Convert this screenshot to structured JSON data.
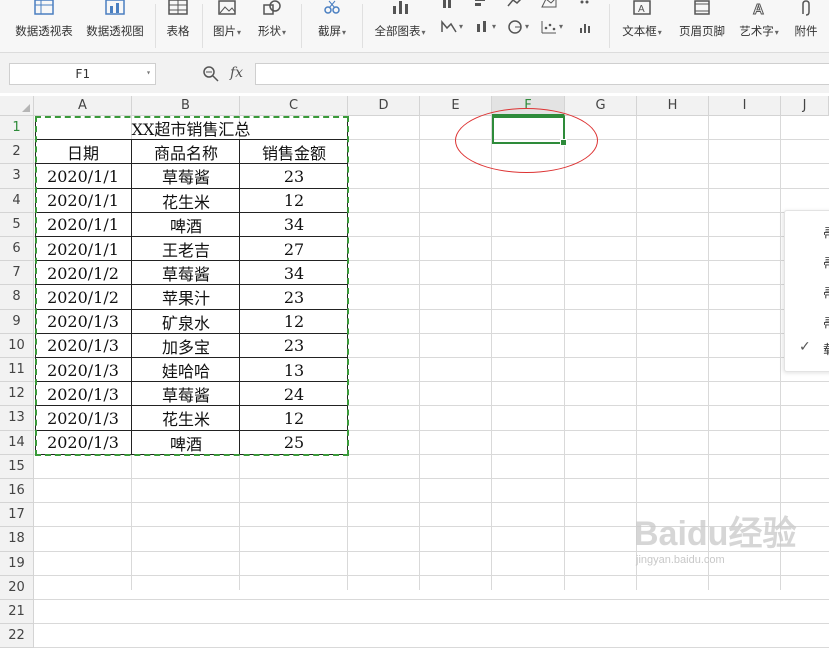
{
  "ribbon": {
    "items": [
      {
        "label": "数据透视表",
        "icon": "pivot-table-icon",
        "dropdown": false
      },
      {
        "label": "数据透视图",
        "icon": "pivot-chart-icon",
        "dropdown": false
      },
      {
        "label": "表格",
        "icon": "table-icon",
        "dropdown": false
      },
      {
        "label": "图片",
        "icon": "picture-icon",
        "dropdown": true
      },
      {
        "label": "形状",
        "icon": "shape-icon",
        "dropdown": true
      },
      {
        "label": "截屏",
        "icon": "screenshot-icon",
        "dropdown": true
      },
      {
        "label": "全部图表",
        "icon": "all-charts-icon",
        "dropdown": true
      },
      {
        "label": "文本框",
        "icon": "textbox-icon",
        "dropdown": true
      },
      {
        "label": "页眉页脚",
        "icon": "header-footer-icon",
        "dropdown": false
      },
      {
        "label": "艺术字",
        "icon": "wordart-icon",
        "dropdown": true
      },
      {
        "label": "附件",
        "icon": "attachment-icon",
        "dropdown": false
      }
    ]
  },
  "formula_bar": {
    "name_box": "F1",
    "fx": "fx",
    "formula": ""
  },
  "columns": [
    "A",
    "B",
    "C",
    "D",
    "E",
    "F",
    "G",
    "H",
    "I",
    "J"
  ],
  "active_column": "F",
  "rows": [
    "1",
    "2",
    "3",
    "4",
    "5",
    "6",
    "7",
    "8",
    "9",
    "10",
    "11",
    "12",
    "13",
    "14",
    "15",
    "16",
    "17",
    "18",
    "19",
    "20",
    "21",
    "22"
  ],
  "active_row": "1",
  "table": {
    "title": "XX超市销售汇总",
    "headers": [
      "日期",
      "商品名称",
      "销售金额"
    ],
    "rows": [
      [
        "2020/1/1",
        "草莓酱",
        "23"
      ],
      [
        "2020/1/1",
        "花生米",
        "12"
      ],
      [
        "2020/1/1",
        "啤酒",
        "34"
      ],
      [
        "2020/1/1",
        "王老吉",
        "27"
      ],
      [
        "2020/1/2",
        "草莓酱",
        "34"
      ],
      [
        "2020/1/2",
        "苹果汁",
        "23"
      ],
      [
        "2020/1/3",
        "矿泉水",
        "12"
      ],
      [
        "2020/1/3",
        "加多宝",
        "23"
      ],
      [
        "2020/1/3",
        "娃哈哈",
        "13"
      ],
      [
        "2020/1/3",
        "草莓酱",
        "24"
      ],
      [
        "2020/1/3",
        "花生米",
        "12"
      ],
      [
        "2020/1/3",
        "啤酒",
        "25"
      ]
    ]
  },
  "popup": {
    "items": [
      "帚",
      "帚",
      "帚",
      "帚",
      "载"
    ],
    "checked_index": 4
  },
  "watermark": {
    "brand": "Baidu经验",
    "url": "jingyan.baidu.com"
  },
  "colors": {
    "accent": "#2e8b3a",
    "marquee": "#3a9a3a",
    "annotation": "#dd3333"
  }
}
